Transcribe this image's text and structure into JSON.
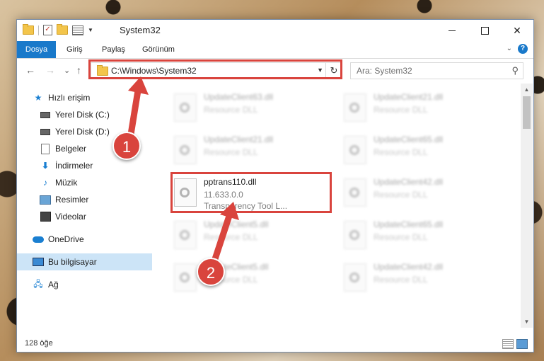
{
  "window": {
    "title": "System32",
    "controls": {
      "minimize": "—",
      "maximize": "□",
      "close": "✕"
    }
  },
  "ribbon": {
    "tabs": [
      "Dosya",
      "Giriş",
      "Paylaş",
      "Görünüm"
    ],
    "help": "?"
  },
  "navigation": {
    "back": "←",
    "forward": "→",
    "recent": "⌄",
    "up": "↑",
    "address": "C:\\Windows\\System32",
    "search_placeholder": "Ara: System32"
  },
  "sidebar": {
    "items": [
      {
        "label": "Hızlı erişim",
        "icon": "star-icon"
      },
      {
        "label": "Yerel Disk (C:)",
        "icon": "drive-icon",
        "pinned": true
      },
      {
        "label": "Yerel Disk (D:)",
        "icon": "drive-icon",
        "pinned": true
      },
      {
        "label": "Belgeler",
        "icon": "document-icon",
        "pinned": true
      },
      {
        "label": "İndirmeler",
        "icon": "download-icon",
        "pinned": true
      },
      {
        "label": "Müzik",
        "icon": "music-icon",
        "pinned": true
      },
      {
        "label": "Resimler",
        "icon": "pictures-icon",
        "pinned": true
      },
      {
        "label": "Videolar",
        "icon": "video-icon",
        "pinned": true
      },
      {
        "label": "OneDrive",
        "icon": "cloud-icon"
      },
      {
        "label": "Bu bilgisayar",
        "icon": "computer-icon",
        "selected": true
      },
      {
        "label": "Ağ",
        "icon": "network-icon"
      }
    ]
  },
  "files": [
    {
      "name": "UpdateClient63.dll",
      "line1": "Resource DLL",
      "line2": "",
      "blurred": true
    },
    {
      "name": "UpdateClient21.dll",
      "line1": "Resource DLL",
      "line2": "",
      "blurred": true
    },
    {
      "name": "UpdateClient21.dll",
      "line1": "Resource DLL",
      "line2": "",
      "blurred": true
    },
    {
      "name": "UpdateClient65.dll",
      "line1": "Resource DLL",
      "line2": "",
      "blurred": true
    },
    {
      "name": "pptrans110.dll",
      "line1": "11.633.0.0",
      "line2": "Transparency Tool L...",
      "blurred": false
    },
    {
      "name": "UpdateClient42.dll",
      "line1": "Resource DLL",
      "line2": "",
      "blurred": true
    },
    {
      "name": "UpdateClient5.dll",
      "line1": "Resource DLL",
      "line2": "",
      "blurred": true
    },
    {
      "name": "UpdateClient65.dll",
      "line1": "Resource DLL",
      "line2": "",
      "blurred": true
    },
    {
      "name": "UpdateClient5.dll",
      "line1": "Resource DLL",
      "line2": "",
      "blurred": true
    },
    {
      "name": "UpdateClient42.dll",
      "line1": "Resource DLL",
      "line2": "",
      "blurred": true
    }
  ],
  "status": {
    "count": "128 öğe"
  },
  "annotations": {
    "step1": "1",
    "step2": "2",
    "color": "#d9443d"
  }
}
